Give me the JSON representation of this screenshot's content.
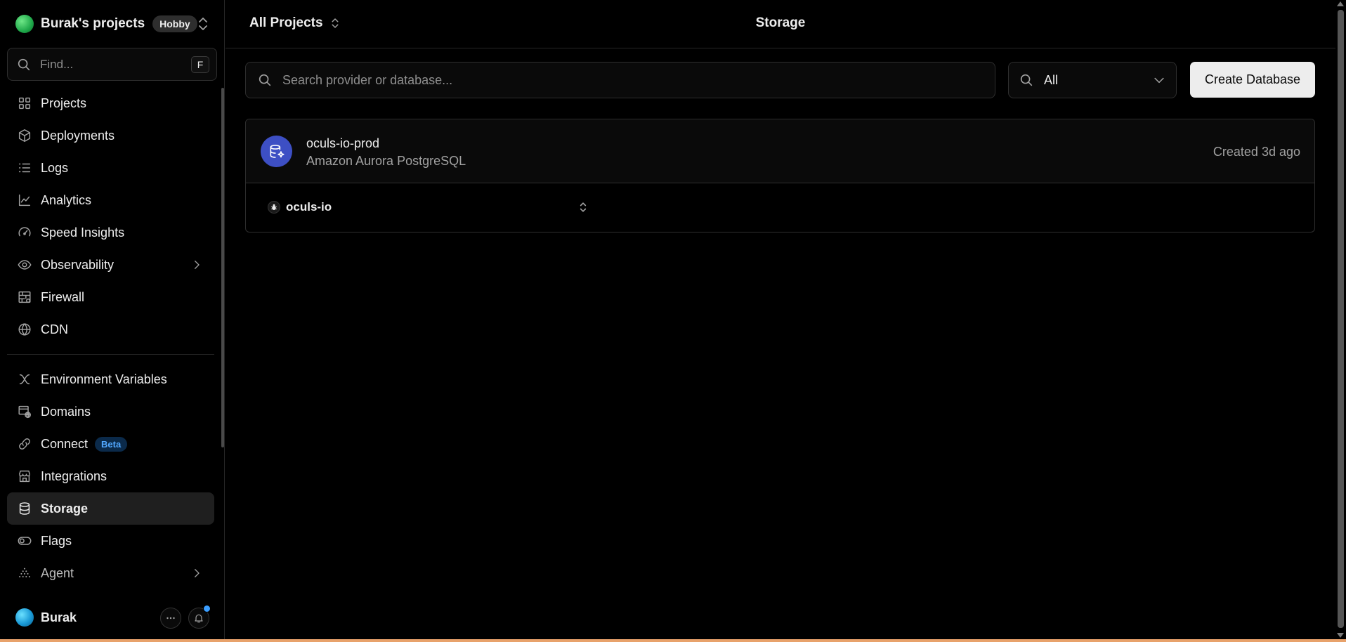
{
  "sidebar": {
    "team": {
      "name": "Burak's projects",
      "plan": "Hobby"
    },
    "find": {
      "placeholder": "Find...",
      "shortcut": "F"
    },
    "nav_primary": [
      {
        "label": "Projects",
        "icon": "grid-icon"
      },
      {
        "label": "Deployments",
        "icon": "cube-icon"
      },
      {
        "label": "Logs",
        "icon": "list-icon"
      },
      {
        "label": "Analytics",
        "icon": "chart-line-icon"
      },
      {
        "label": "Speed Insights",
        "icon": "gauge-icon"
      },
      {
        "label": "Observability",
        "icon": "eye-icon",
        "has_submenu": true
      },
      {
        "label": "Firewall",
        "icon": "firewall-icon"
      },
      {
        "label": "CDN",
        "icon": "globe-icon"
      }
    ],
    "nav_secondary": [
      {
        "label": "Environment Variables",
        "icon": "variables-icon"
      },
      {
        "label": "Domains",
        "icon": "domain-icon"
      },
      {
        "label": "Connect",
        "icon": "link-icon",
        "badge": "Beta"
      },
      {
        "label": "Integrations",
        "icon": "store-icon"
      },
      {
        "label": "Storage",
        "icon": "database-icon",
        "active": true
      },
      {
        "label": "Flags",
        "icon": "toggle-icon"
      },
      {
        "label": "Agent",
        "icon": "agent-icon",
        "has_submenu": true
      }
    ],
    "user": {
      "name": "Burak"
    }
  },
  "header": {
    "project_switcher": "All Projects",
    "title": "Storage"
  },
  "main": {
    "search": {
      "placeholder": "Search provider or database..."
    },
    "filter": {
      "value": "All"
    },
    "create_button": "Create Database",
    "databases": [
      {
        "name": "oculs-io-prod",
        "provider": "Amazon Aurora PostgreSQL",
        "created": "Created 3d ago",
        "project": "oculs-io"
      }
    ]
  },
  "colors": {
    "background": "#000000",
    "border": "#2e2e2e",
    "text_primary": "#ededed",
    "text_secondary": "#a1a1a1",
    "db_icon": "#3d4fc4",
    "beta_badge_bg": "#0b2a4a",
    "beta_badge_text": "#52a8ff",
    "notification_dot": "#3b9eff",
    "button_bg": "#ededed"
  }
}
